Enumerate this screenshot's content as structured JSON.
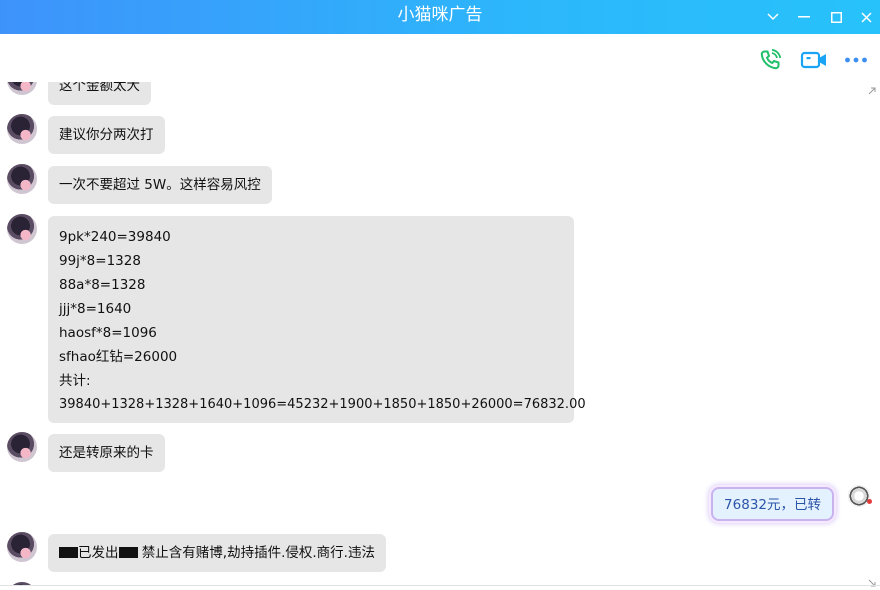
{
  "window": {
    "title": "小猫咪广告",
    "controls": [
      "chevron-down-icon",
      "minimize-icon",
      "maximize-icon",
      "close-icon"
    ]
  },
  "toolbar": {
    "icons": [
      "phone-call-icon",
      "video-call-icon",
      "more-icon"
    ],
    "colors": {
      "phone": "#1fbf6a",
      "video": "#1aa4f5",
      "more": "#3a8ff0"
    }
  },
  "theme": {
    "titlebar_from": "#3e93fb",
    "titlebar_to": "#27c2fb",
    "bubble_bg": "#e6e6e6",
    "my_text": "#2a55a8"
  },
  "messages": [
    {
      "sender": "contact",
      "text": "这个金额太大"
    },
    {
      "sender": "contact",
      "text": "建议你分两次打"
    },
    {
      "sender": "contact",
      "text": "一次不要超过 5W。这样容易风控"
    },
    {
      "sender": "contact",
      "lines": [
        "9pk*240=39840",
        "99j*8=1328",
        "88a*8=1328",
        "jjj*8=1640",
        "haosf*8=1096",
        "sfhao红钻=26000",
        "共计:",
        "39840+1328+1328+1640+1096=45232+1900+1850+1850+26000=76832.00"
      ]
    },
    {
      "sender": "contact",
      "text": "还是转原来的卡"
    },
    {
      "sender": "me",
      "text": "76832元，已转"
    },
    {
      "sender": "contact",
      "prefix": "已发出",
      "text": "禁止含有赌博,劫持插件.侵权.商行.违法"
    }
  ]
}
